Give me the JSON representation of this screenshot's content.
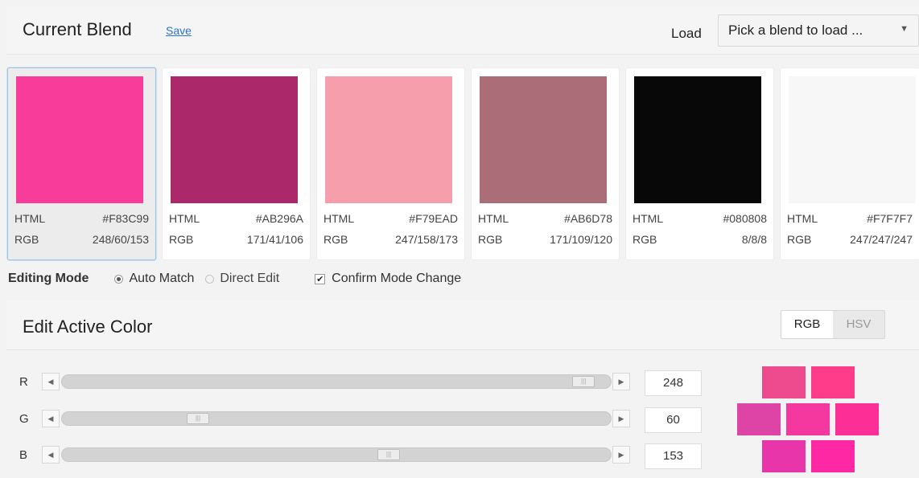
{
  "header": {
    "title": "Current Blend",
    "save_label": "Save",
    "load_label": "Load",
    "load_placeholder": "Pick a blend to load ...",
    "caret_icon": "chevron-down-icon"
  },
  "swatches": [
    {
      "color": "#F83C99",
      "html_label": "HTML",
      "html": "#F83C99",
      "rgb_label": "RGB",
      "rgb": "248/60/153",
      "active": true
    },
    {
      "color": "#AB296A",
      "html_label": "HTML",
      "html": "#AB296A",
      "rgb_label": "RGB",
      "rgb": "171/41/106",
      "active": false
    },
    {
      "color": "#F79EAD",
      "html_label": "HTML",
      "html": "#F79EAD",
      "rgb_label": "RGB",
      "rgb": "247/158/173",
      "active": false
    },
    {
      "color": "#AB6D78",
      "html_label": "HTML",
      "html": "#AB6D78",
      "rgb_label": "RGB",
      "rgb": "171/109/120",
      "active": false
    },
    {
      "color": "#080808",
      "html_label": "HTML",
      "html": "#080808",
      "rgb_label": "RGB",
      "rgb": "8/8/8",
      "active": false
    },
    {
      "color": "#F7F7F7",
      "html_label": "HTML",
      "html": "#F7F7F7",
      "rgb_label": "RGB",
      "rgb": "247/247/247",
      "active": false
    }
  ],
  "editing_mode": {
    "label": "Editing Mode",
    "auto_match": "Auto Match",
    "direct_edit": "Direct Edit",
    "confirm": "Confirm Mode Change",
    "selected": "auto_match",
    "confirm_checked": true
  },
  "edit_panel": {
    "title": "Edit Active Color",
    "mode_rgb": "RGB",
    "mode_hsv": "HSV",
    "active_mode": "RGB",
    "channels": [
      {
        "label": "R",
        "value": "248",
        "max": 255
      },
      {
        "label": "G",
        "value": "60",
        "max": 255
      },
      {
        "label": "B",
        "value": "153",
        "max": 255
      }
    ],
    "variations": [
      "#EE4A8E",
      "#FE3C8A",
      "#DD44A6",
      "#F538A0",
      "#FE2E97",
      "#E836AA",
      "#FE28A4"
    ]
  }
}
